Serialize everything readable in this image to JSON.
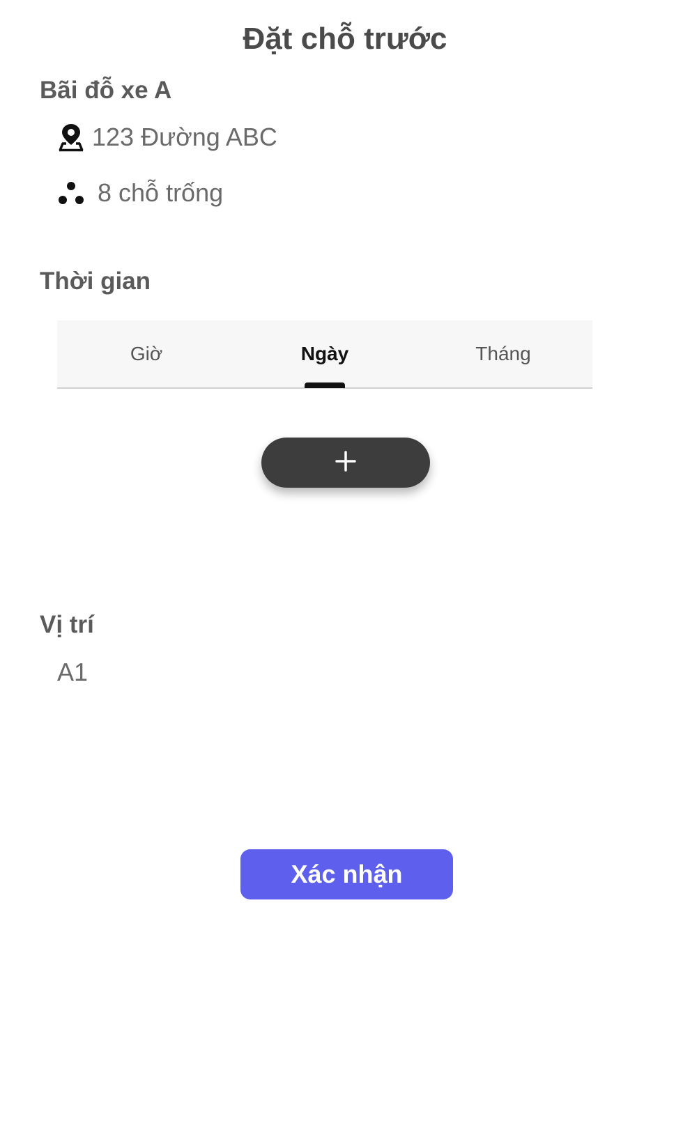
{
  "header": {
    "title": "Đặt chỗ trước"
  },
  "parking_lot": {
    "name": "Bãi đỗ xe A",
    "address": "123 Đường ABC",
    "available_spots": "8 chỗ trống",
    "address_icon": "map-pin-icon",
    "spots_icon": "three-dots-icon"
  },
  "time_section": {
    "heading": "Thời gian",
    "tabs": [
      {
        "label": "Giờ",
        "active": false
      },
      {
        "label": "Ngày",
        "active": true
      },
      {
        "label": "Tháng",
        "active": false
      }
    ],
    "add_icon": "plus-icon"
  },
  "position_section": {
    "heading": "Vị trí",
    "value": "A1"
  },
  "actions": {
    "confirm_label": "Xác nhận"
  },
  "colors": {
    "primary": "#5e5fec",
    "add_button": "#3d3d3d",
    "active_tab": "#111111"
  }
}
